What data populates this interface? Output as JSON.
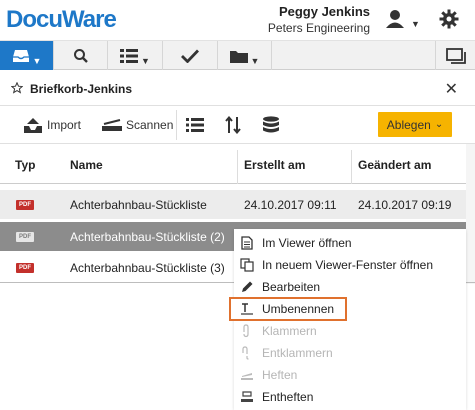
{
  "app": {
    "logo": "DocuWare"
  },
  "user": {
    "name": "Peggy Jenkins",
    "company": "Peters Engineering"
  },
  "icons": {
    "user": "user-icon",
    "gear": "gear-icon",
    "tray": "tray-icon",
    "search": "search-icon",
    "list": "list-icon",
    "check": "check-icon",
    "folder": "folder-icon",
    "window": "window-icon"
  },
  "colors": {
    "accent": "#1e78c8",
    "ablegen": "#f6b300",
    "selected_row": "#8c8c8c",
    "highlight_border": "#e0712e",
    "pdf_red": "#c3302b"
  },
  "basket": {
    "title": "Briefkorb-Jenkins",
    "close": "✕"
  },
  "toolbar": {
    "import": "Import",
    "scan": "Scannen",
    "ablegen": "Ablegen"
  },
  "table": {
    "headers": {
      "type": "Typ",
      "name": "Name",
      "created": "Erstellt am",
      "modified": "Geändert am"
    },
    "rows": [
      {
        "type": "PDF",
        "name": "Achterbahnbau-Stückliste",
        "created": "24.10.2017 09:11",
        "modified": "24.10.2017 09:19"
      },
      {
        "type": "PDF",
        "name": "Achterbahnbau-Stückliste (2)",
        "created": "",
        "modified": ""
      },
      {
        "type": "PDF",
        "name": "Achterbahnbau-Stückliste (3)",
        "created": "",
        "modified": ""
      }
    ]
  },
  "context_menu": {
    "items": [
      {
        "label": "Im Viewer öffnen",
        "enabled": true
      },
      {
        "label": "In neuem Viewer-Fenster öffnen",
        "enabled": true
      },
      {
        "label": "Bearbeiten",
        "enabled": true
      },
      {
        "label": "Umbenennen",
        "enabled": true,
        "highlighted": true
      },
      {
        "label": "Klammern",
        "enabled": false
      },
      {
        "label": "Entklammern",
        "enabled": false
      },
      {
        "label": "Heften",
        "enabled": false
      },
      {
        "label": "Entheften",
        "enabled": true
      }
    ]
  }
}
